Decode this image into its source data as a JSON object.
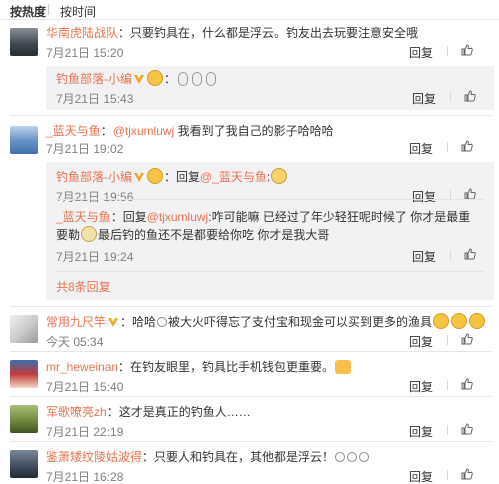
{
  "tabs": {
    "hot": "按热度",
    "time": "按时间"
  },
  "actions": {
    "reply": "回复"
  },
  "comments": [
    {
      "nick": "华南虎陆战队",
      "text": "：只要钓具在，什么都是浮云。钓友出去玩要注意安全哦",
      "time": "7月21日 15:20",
      "avatar_color": "#4a4f57",
      "replies": [
        {
          "nick": "钓鱼部落-小编",
          "text": "",
          "time": "7月21日 15:43"
        }
      ]
    },
    {
      "nick": "_蓝天与鱼",
      "mention": "@tjxumluwj",
      "text": "我看到了我自己的影子哈哈哈",
      "time": "7月21日 19:02",
      "avatar_color": "#6a94c9",
      "replies": [
        {
          "nick": "钓鱼部落-小编",
          "pre": "：回复",
          "mention": "@_蓝天与鱼",
          "text": ":",
          "time": "7月21日 19:56"
        },
        {
          "nick": "_蓝天与鱼",
          "pre": "：回复",
          "mention": "@tjxumluwj",
          "text": ":咋可能嘛 已经过了年少轻狂呢时候了 你才是最重要勒",
          "text2": "最后钓的鱼还不是都要给你吃 你才是我大哥",
          "time": "7月21日 19:24"
        }
      ],
      "more": "共8条回复"
    },
    {
      "nick": "常用九尺竿",
      "text": "：哈哈",
      "text_mid": "被大火吓得忘了支付宝和现金可以买到更多的渔具",
      "time": "今天 05:34",
      "avatar_color": "#d6d6d6"
    },
    {
      "nick": "mr_heweinan",
      "text": "：在钓友眼里，钓具比手机钱包更重要。",
      "time": "7月21日 15:40",
      "avatar_color": "#c23b3b"
    },
    {
      "nick": "军歌嘹亮zh",
      "text": "：这才是真正的钓鱼人……",
      "time": "7月21日 22:19",
      "avatar_color": "#6f8a3c"
    },
    {
      "nick": "鉴萧矮纹陵姑波得",
      "text": "：只要人和钓具在，其他都是浮云！",
      "time": "7月21日 16:28",
      "avatar_color": "#3d4a5a"
    }
  ]
}
